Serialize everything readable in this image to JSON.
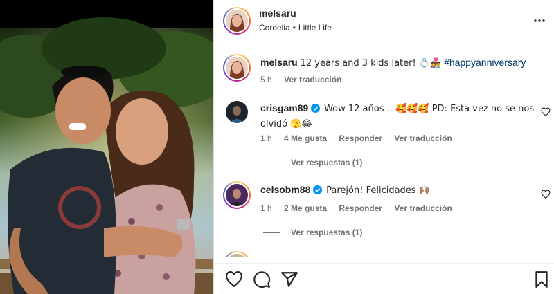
{
  "post": {
    "username": "melsaru",
    "audio_artist": "Cordelia",
    "separator": "•",
    "audio_title": "Little Life"
  },
  "caption": {
    "username": "melsaru",
    "text": "12 years and 3 kids later! 💍👩‍❤️‍👨",
    "hashtag": "#happyanniversary",
    "time": "5 h",
    "translate": "Ver traducción"
  },
  "comments": [
    {
      "username": "crisgam89",
      "verified": true,
      "text": "Wow 12 años .. 🥰🥰🥰 PD: Esta vez no se nos olvidó 🫣😂",
      "time": "1 h",
      "likes": "4 Me gusta",
      "reply": "Responder",
      "translate": "Ver traducción",
      "view_replies": "Ver respuestas (1)"
    },
    {
      "username": "celsobm88",
      "verified": true,
      "text": "Parejón! Felicidades 🙌🏽",
      "time": "1 h",
      "likes": "2 Me gusta",
      "reply": "Responder",
      "translate": "Ver traducción",
      "view_replies": "Ver respuestas (1)"
    }
  ],
  "icons": {
    "more": "more-icon",
    "like": "heart-icon",
    "comment": "comment-icon",
    "share": "paper-plane-icon",
    "save": "bookmark-icon",
    "verified": "verified-badge-icon"
  },
  "colors": {
    "link": "#00376b",
    "verified": "#0095f6",
    "muted": "#737373",
    "text": "#262626"
  }
}
